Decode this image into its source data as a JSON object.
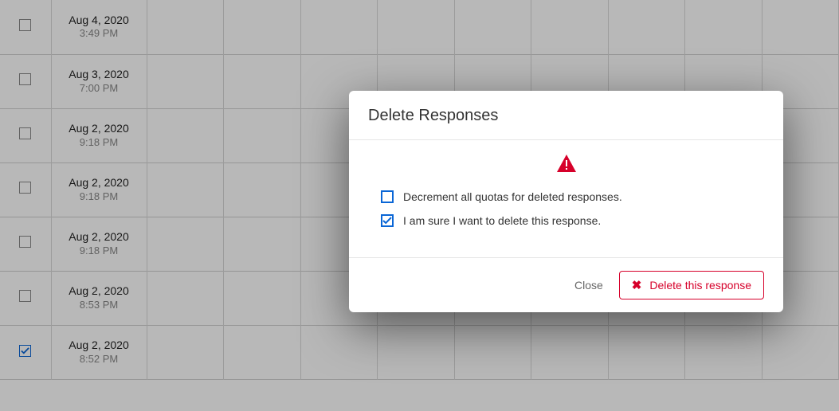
{
  "table": {
    "rows": [
      {
        "date": "Aug 4, 2020",
        "time": "3:49 PM",
        "checked": false
      },
      {
        "date": "Aug 3, 2020",
        "time": "7:00 PM",
        "checked": false
      },
      {
        "date": "Aug 2, 2020",
        "time": "9:18 PM",
        "checked": false
      },
      {
        "date": "Aug 2, 2020",
        "time": "9:18 PM",
        "checked": false
      },
      {
        "date": "Aug 2, 2020",
        "time": "9:18 PM",
        "checked": false
      },
      {
        "date": "Aug 2, 2020",
        "time": "8:53 PM",
        "checked": false
      },
      {
        "date": "Aug 2, 2020",
        "time": "8:52 PM",
        "checked": true
      }
    ]
  },
  "modal": {
    "title": "Delete Responses",
    "options": {
      "decrement": {
        "label": "Decrement all quotas for deleted responses.",
        "checked": false
      },
      "confirm": {
        "label": "I am sure I want to delete this response.",
        "checked": true
      }
    },
    "buttons": {
      "close": "Close",
      "delete": "Delete this response"
    }
  }
}
